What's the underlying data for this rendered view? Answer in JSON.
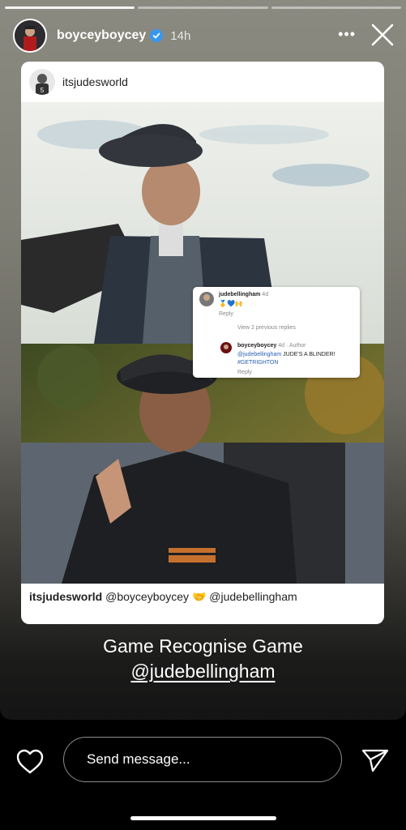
{
  "story": {
    "progress_segments": 3,
    "active_segment": 1,
    "username": "boyceyboycey",
    "time": "14h",
    "more_label": "•••"
  },
  "post": {
    "username": "itsjudesworld",
    "caption_user": "itsjudesworld",
    "caption_text": "@boyceyboycey 🤝 @judebellingham"
  },
  "comment": {
    "user1": "judebellingham",
    "time1": "4d",
    "emojis": "🥇💙🙌",
    "reply1": "Reply",
    "view_replies": "View 2 previous replies",
    "user2": "boyceyboycey",
    "time2": "4d · Author",
    "mention2": "@judebellingham",
    "text2": "JUDE'S A BLINDER!",
    "hashtag2": "#GETRIGHTON",
    "reply2": "Reply"
  },
  "story_text": {
    "line1": "Game Recognise Game",
    "line2": "@judebellingham"
  },
  "composer": {
    "placeholder": "Send message..."
  },
  "colors": {
    "verified": "#3897f0",
    "link": "#2a5db0"
  }
}
